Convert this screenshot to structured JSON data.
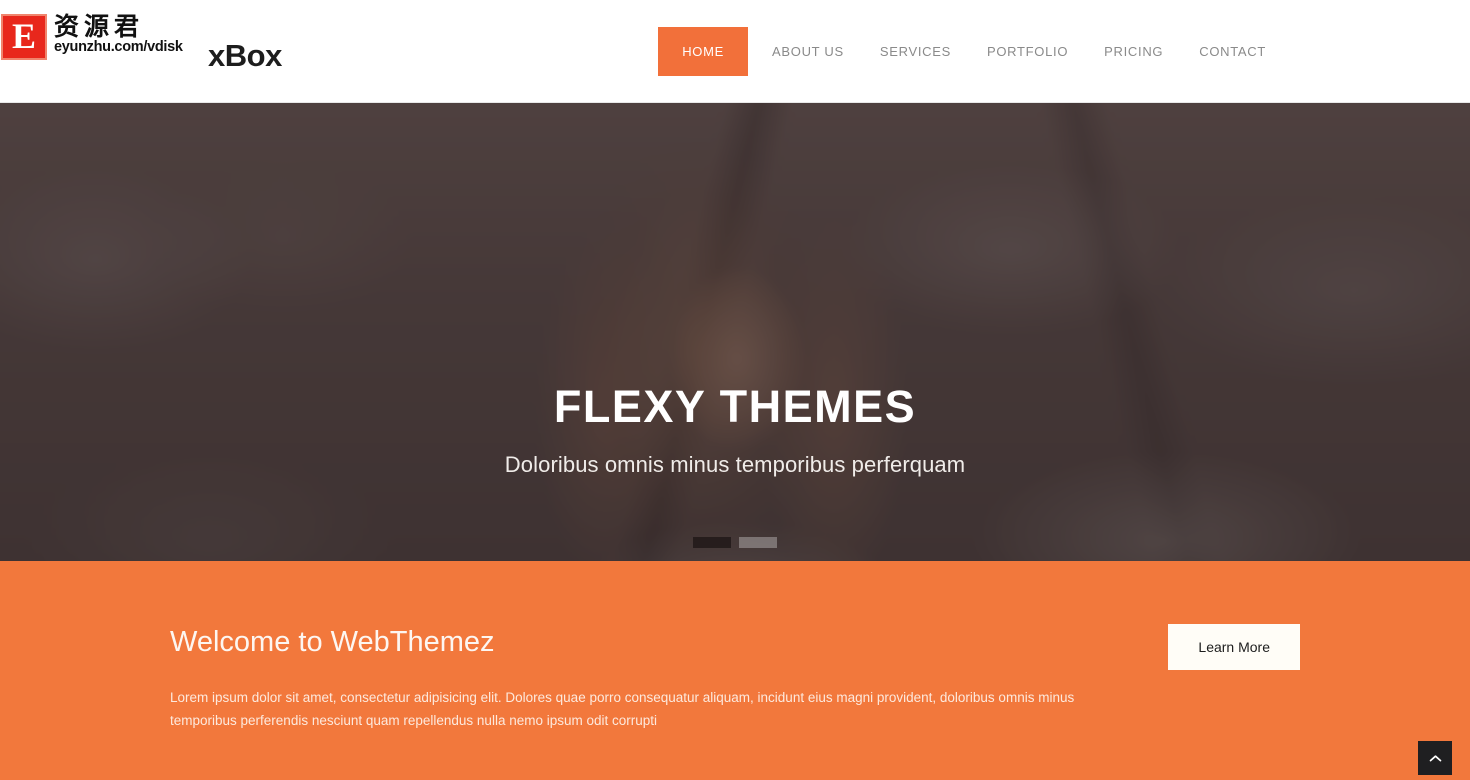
{
  "header": {
    "logo_text": "xBox",
    "watermark": {
      "badge_letter": "E",
      "cn_text": "资源君",
      "url_text": "eyunzhu.com/vdisk"
    },
    "nav": [
      {
        "label": "HOME",
        "active": true
      },
      {
        "label": "ABOUT US",
        "active": false
      },
      {
        "label": "SERVICES",
        "active": false
      },
      {
        "label": "PORTFOLIO",
        "active": false
      },
      {
        "label": "PRICING",
        "active": false
      },
      {
        "label": "CONTACT",
        "active": false
      }
    ]
  },
  "hero": {
    "title": "FLEXY THEMES",
    "subtitle": "Doloribus omnis minus temporibus perferquam",
    "slides": [
      {
        "active": true
      },
      {
        "active": false
      }
    ]
  },
  "welcome": {
    "title": "Welcome to WebThemez",
    "paragraph": "Lorem ipsum dolor sit amet, consectetur adipisicing elit. Dolores quae porro consequatur aliquam, incidunt eius magni provident, doloribus omnis minus temporibus perferendis nesciunt quam repellendus nulla nemo ipsum odit corrupti",
    "button_label": "Learn More"
  },
  "back_to_top": {
    "icon": "chevron-up-icon"
  },
  "colors": {
    "accent_orange": "#f2783c",
    "nav_active": "#f2703a",
    "nav_text": "#8a8a8a",
    "button_bg": "#fffdf7",
    "back_to_top_bg": "#1f1f21",
    "watermark_red": "#e8271c"
  }
}
